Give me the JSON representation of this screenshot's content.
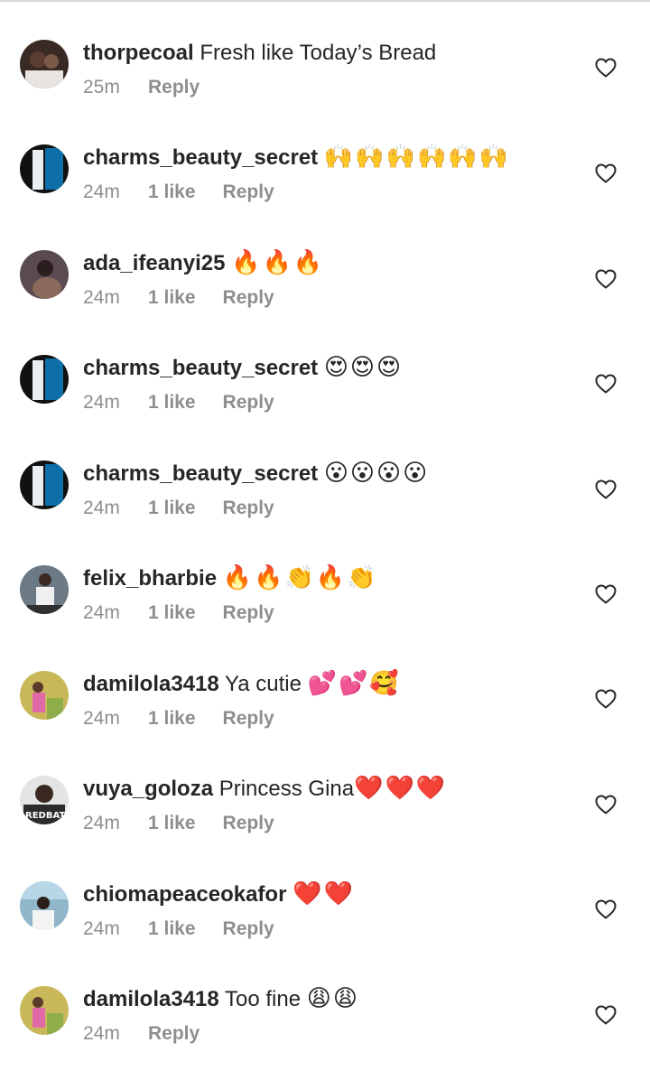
{
  "comments": [
    {
      "username": "thorpecoal",
      "text": "Fresh like Today’s Bread",
      "emoji": "",
      "time": "25m",
      "likes": "",
      "reply": "Reply",
      "avatar_color": "#3a2a24"
    },
    {
      "username": "charms_beauty_secret",
      "text": "",
      "emoji": "🙌🙌🙌🙌🙌🙌",
      "time": "24m",
      "likes": "1 like",
      "reply": "Reply",
      "avatar_color": "#0d6ea8"
    },
    {
      "username": "ada_ifeanyi25",
      "text": "",
      "emoji": "🔥🔥🔥",
      "time": "24m",
      "likes": "1 like",
      "reply": "Reply",
      "avatar_color": "#5a4b52"
    },
    {
      "username": "charms_beauty_secret",
      "text": "",
      "emoji": "😍😍😍",
      "time": "24m",
      "likes": "1 like",
      "reply": "Reply",
      "avatar_color": "#0d6ea8"
    },
    {
      "username": "charms_beauty_secret",
      "text": "",
      "emoji": "😮😮😮😮",
      "time": "24m",
      "likes": "1 like",
      "reply": "Reply",
      "avatar_color": "#0d6ea8"
    },
    {
      "username": "felix_bharbie",
      "text": "",
      "emoji": "🔥🔥👏🔥👏",
      "time": "24m",
      "likes": "1 like",
      "reply": "Reply",
      "avatar_color": "#6c7a86"
    },
    {
      "username": "damilola3418",
      "text": "Ya cutie",
      "emoji": "💕💕🥰",
      "time": "24m",
      "likes": "1 like",
      "reply": "Reply",
      "avatar_color": "#c8b85a"
    },
    {
      "username": "vuya_goloza",
      "text": "Princess Gina",
      "emoji": "❤️❤️❤️",
      "time": "24m",
      "likes": "1 like",
      "reply": "Reply",
      "avatar_color": "#2b2b2b"
    },
    {
      "username": "chiomapeaceokafor",
      "text": "",
      "emoji": "❤️❤️",
      "time": "24m",
      "likes": "1 like",
      "reply": "Reply",
      "avatar_color": "#8fb6c9"
    },
    {
      "username": "damilola3418",
      "text": "Too fine",
      "emoji": "😩😩",
      "time": "24m",
      "likes": "",
      "reply": "Reply",
      "avatar_color": "#c8b85a"
    }
  ]
}
